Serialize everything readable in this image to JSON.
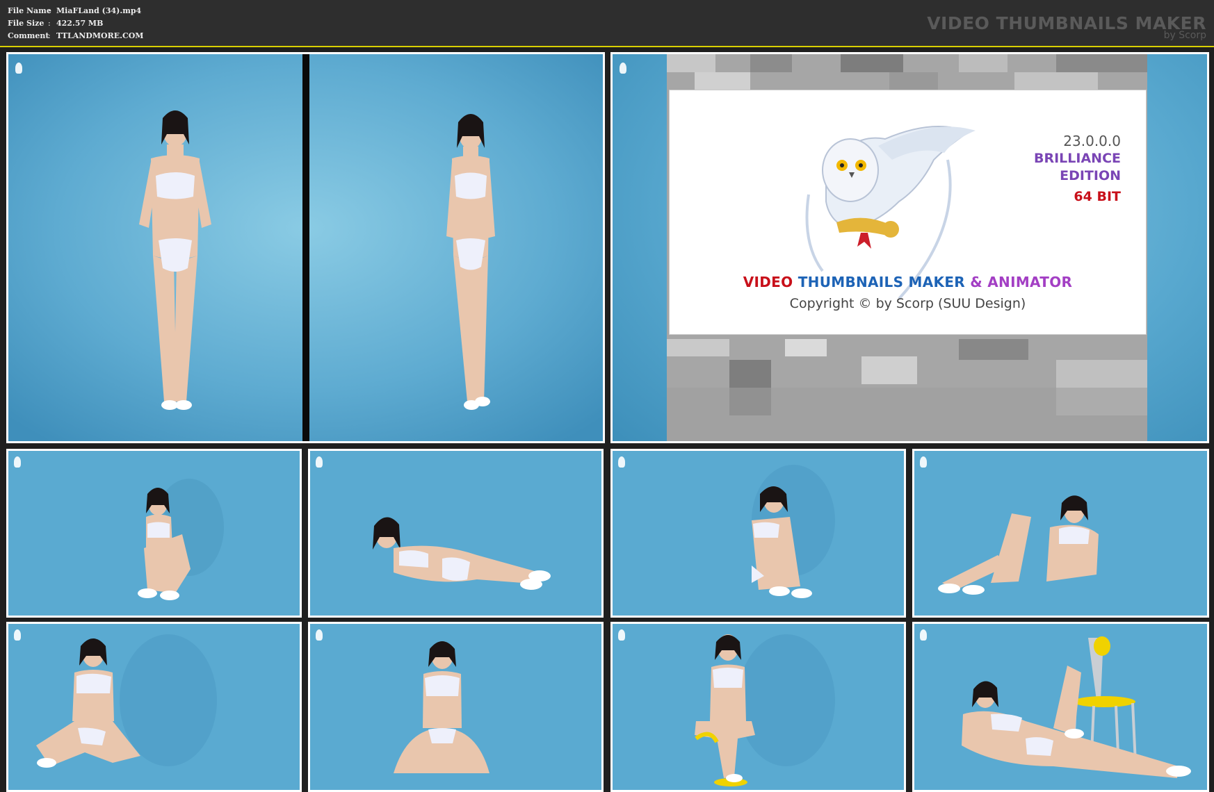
{
  "header": {
    "fields": [
      {
        "label": "File Name",
        "value": "MiaFLand (34).mp4"
      },
      {
        "label": "File Size",
        "value": "422.57 MB"
      },
      {
        "label": "Comment",
        "value": "TTLANDMORE.COM"
      }
    ],
    "brand_title": "VIDEO THUMBNAILS MAKER",
    "brand_sub": "by Scorp"
  },
  "splash": {
    "version": "23.0.0.0",
    "edition_line1": "BRILLIANCE",
    "edition_line2": "EDITION",
    "bits": "64 BIT",
    "title_video": "VIDEO",
    "title_maker": "THUMBNAILS MAKER",
    "title_amp": "&",
    "title_animator": "ANIMATOR",
    "copyright": "Copyright © by Scorp (SUU Design)"
  },
  "colors": {
    "background": "#1f1f1f",
    "header": "#2e2e2e",
    "accent_rule": "#d8d000",
    "tile_border": "#ffffff",
    "studio_blue": "#58a8cf"
  },
  "thumbnails": [
    {
      "pose": "standing-front"
    },
    {
      "pose": "standing-front-2"
    },
    {
      "pose": "sitting-knees-up"
    },
    {
      "pose": "lying-side"
    },
    {
      "pose": "sitting-hug-knees"
    },
    {
      "pose": "reclining-legs-up"
    },
    {
      "pose": "kneeling-smile"
    },
    {
      "pose": "kneeling-front"
    },
    {
      "pose": "sitting-chair"
    },
    {
      "pose": "reclining-chair"
    }
  ]
}
